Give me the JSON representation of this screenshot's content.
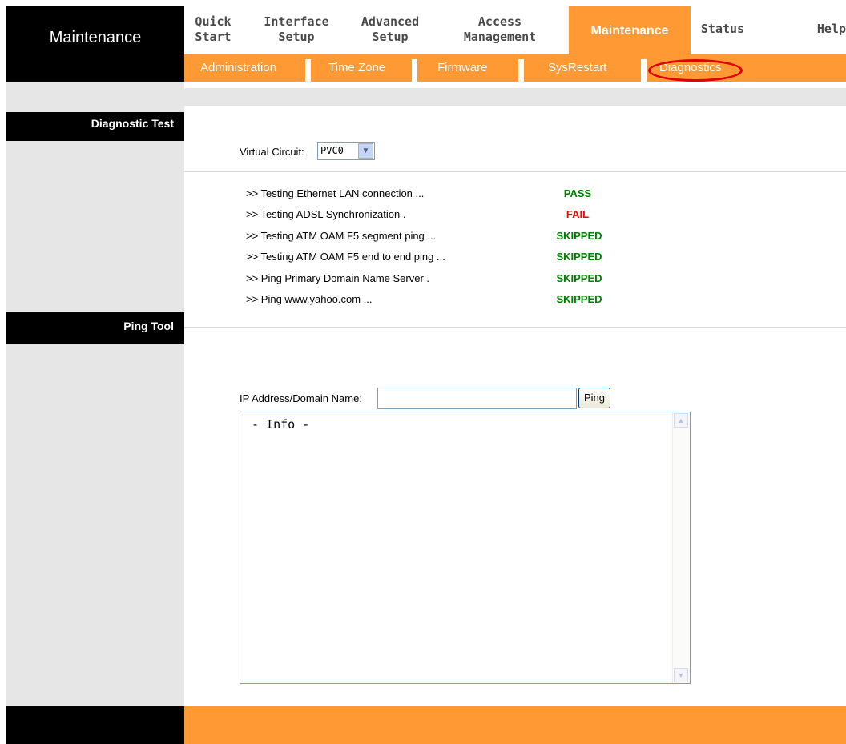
{
  "header": {
    "brand": "Maintenance",
    "nav": [
      {
        "line1": "Quick",
        "line2": "Start"
      },
      {
        "line1": "Interface",
        "line2": "Setup"
      },
      {
        "line1": "Advanced",
        "line2": "Setup"
      },
      {
        "line1": "Access",
        "line2": "Management"
      },
      {
        "line1": "Maintenance",
        "line2": ""
      },
      {
        "line1": "Status",
        "line2": ""
      },
      {
        "line1": "Help",
        "line2": ""
      }
    ],
    "active_nav": "Maintenance",
    "subnav": [
      "Administration",
      "Time Zone",
      "Firmware",
      "SysRestart",
      "Diagnostics"
    ],
    "active_subnav": "Diagnostics"
  },
  "sidebar": {
    "diagnostic_test": "Diagnostic Test",
    "ping_tool": "Ping Tool"
  },
  "diagnostic": {
    "virtual_circuit_label": "Virtual Circuit:",
    "virtual_circuit_value": "PVC0",
    "tests": [
      {
        "label": ">> Testing Ethernet LAN connection ...",
        "result": "PASS"
      },
      {
        "label": ">> Testing ADSL Synchronization .",
        "result": "FAIL"
      },
      {
        "label": ">> Testing ATM OAM F5 segment ping ...",
        "result": "SKIPPED"
      },
      {
        "label": ">> Testing ATM OAM F5 end to end ping ...",
        "result": "SKIPPED"
      },
      {
        "label": ">> Ping Primary Domain Name Server .",
        "result": "SKIPPED"
      },
      {
        "label": ">> Ping www.yahoo.com ...",
        "result": "SKIPPED"
      }
    ]
  },
  "ping": {
    "ip_label": "IP Address/Domain Name:",
    "ip_value": "",
    "button": "Ping",
    "info_text": "- Info -"
  },
  "colors": {
    "accent": "#ff9933",
    "pass": "#008000",
    "fail": "#ff0000",
    "skipped": "#008000"
  }
}
